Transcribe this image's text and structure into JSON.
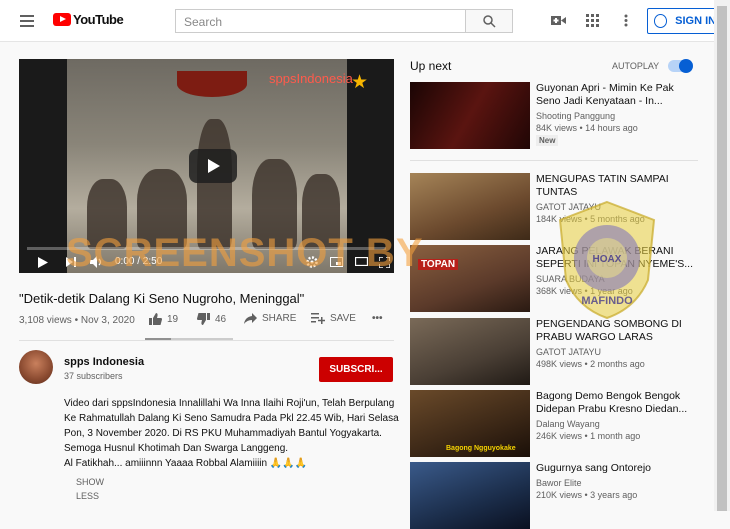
{
  "header": {
    "logo_text": "YouTube",
    "search_placeholder": "Search",
    "signin_label": "SIGN IN"
  },
  "player": {
    "channel_watermark": "sppsIndonesia",
    "time": "0:00 / 2:50",
    "progress": 0
  },
  "overlay": {
    "text": "SCREENSHOT BY"
  },
  "video": {
    "title": "\"Detik-detik Dalang Ki Seno Nugroho, Meninggal\"",
    "views_date": "3,108 views • Nov 3, 2020",
    "likes": "19",
    "dislikes": "46",
    "share_label": "SHARE",
    "save_label": "SAVE",
    "more_label": "•••"
  },
  "channel": {
    "name": "spps Indonesia",
    "subscribers": "37 subscribers",
    "subscribe_label": "SUBSCRI..."
  },
  "description": {
    "lines": [
      "Video dari sppsIndonesia Innalillahi Wa Inna Ilaihi Roji'un, Telah Berpulang",
      "Ke Rahmatullah Dalang Ki Seno Samudra Pada Pkl 22.45 Wib, Hari Selasa",
      "Pon, 3 November 2020. Di RS PKU Muhammadiyah Bantul Yogyakarta.",
      "Semoga Husnul Khotimah Dan Swarga Langgeng.",
      "Al Fatikhah... amiiinnn Yaaaa Robbal Alamiiiin 🙏🙏🙏"
    ],
    "show_label": "SHOW",
    "less_label": "LESS"
  },
  "sidebar": {
    "upnext_label": "Up next",
    "autoplay_label": "AUTOPLAY",
    "autoplay_on": true,
    "items": [
      {
        "title": "Guyonan Apri - Mimin Ke Pak Seno Jadi Kenyataan - In...",
        "channel": "Shooting Panggung",
        "meta": "84K views • 14 hours ago",
        "badge": "New",
        "thumb_color": "#2a0a08"
      },
      {
        "title": "MENGUPAS TATIN SAMPAI TUNTAS",
        "channel": "GATOT JATAYU",
        "meta": "184K views • 5 months ago",
        "thumb_color": "#6c4a2e"
      },
      {
        "title": "JARANG PELAWAK BERANI SEPERTI INI TOPAN NYEME'S...",
        "channel": "SUARA BUDAYA",
        "meta": "368K views • 1 year ago",
        "thumb_color": "#5b3a2a",
        "thumb_label": "TOPAN"
      },
      {
        "title": "PENGENDANG SOMBONG DI PRABU WARGO LARAS",
        "channel": "GATOT JATAYU",
        "meta": "498K views • 2 months ago",
        "thumb_color": "#4a3f35"
      },
      {
        "title": "Bagong Demo Bengok Bengok Didepan Prabu Kresno Diedan...",
        "channel": "Dalang Wayang",
        "meta": "246K views • 1 month ago",
        "thumb_color": "#3b2716",
        "thumb_label": "Bagong Ngguyokake"
      },
      {
        "title": "Gugurnya sang Ontorejo",
        "channel": "Bawor Elite",
        "meta": "210K views • 3 years ago",
        "thumb_color": "#1b2d4a"
      }
    ]
  },
  "seal": {
    "text": "MAFINDO",
    "center": "HOAX"
  }
}
